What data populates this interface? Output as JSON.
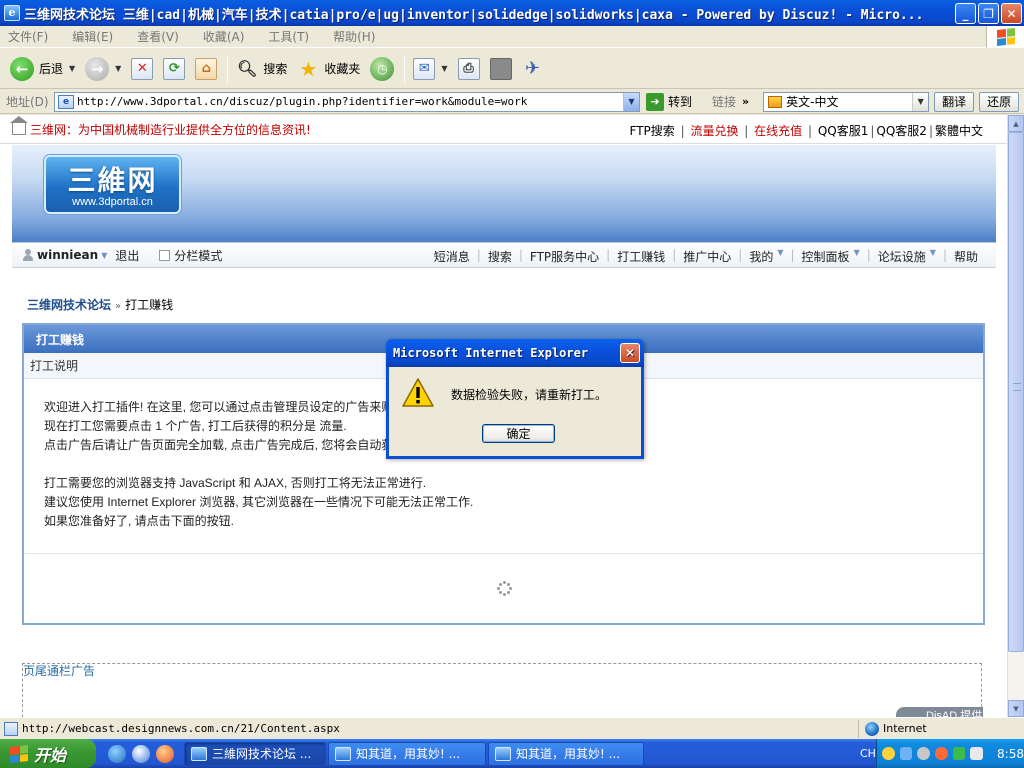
{
  "window": {
    "title": "三维网技术论坛 三维|cad|机械|汽车|技术|catia|pro/e|ug|inventor|solidedge|solidworks|caxa - Powered by Discuz! - Micro...",
    "min": "_",
    "max": "❐",
    "close": "✕"
  },
  "menu": [
    "文件(F)",
    "编辑(E)",
    "查看(V)",
    "收藏(A)",
    "工具(T)",
    "帮助(H)"
  ],
  "toolbar": {
    "back": "后退",
    "search": "搜索",
    "favorites": "收藏夹"
  },
  "address": {
    "label": "地址(D)",
    "url": "http://www.3dportal.cn/discuz/plugin.php?identifier=work&module=work",
    "goto": "转到",
    "links": "链接",
    "chevron": "»",
    "translate_select": "英文-中文",
    "translate_btn": "翻译",
    "restore_btn": "还原"
  },
  "page": {
    "slogan": "三维网：为中国机械制造行业提供全方位的信息资讯!",
    "toplinks": [
      {
        "text": "FTP搜索",
        "red": false
      },
      {
        "text": "流量兑换",
        "red": true
      },
      {
        "text": "在线充值",
        "red": true
      },
      {
        "text": "QQ客服1",
        "red": false
      },
      {
        "text": "QQ客服2",
        "red": false
      },
      {
        "text": "繁體中文",
        "red": false
      }
    ],
    "logo_big": "三維网",
    "logo_small": "www.3dportal.cn",
    "user": "winniean",
    "logout": "退出",
    "split_mode": "分栏模式",
    "nav": [
      "短消息",
      "搜索",
      "FTP服务中心",
      "打工赚钱",
      "推广中心",
      "我的",
      "控制面板",
      "论坛设施",
      "帮助"
    ],
    "breadcrumb_site": "三维网技术论坛",
    "breadcrumb_sep": "»",
    "breadcrumb_current": "打工赚钱",
    "box_title": "打工赚钱",
    "box_subtitle": "打工说明",
    "box_lines": [
      "欢迎进入打工插件! 在这里, 您可以通过点击管理员设定的广告来赚",
      "现在打工您需要点击  1 个广告, 打工后获得的积分是  流量.",
      "点击广告后请让广告页面完全加载, 点击广告完成后, 您将会自动获"
    ],
    "box_lines2": [
      "打工需要您的浏览器支持  JavaScript 和  AJAX, 否则打工将无法正常进行.",
      "建议您使用  Internet Explorer 浏览器, 其它浏览器在一些情况下可能无法正常工作.",
      "如果您准备好了, 请点击下面的按钮."
    ],
    "ad_label": "页尾通栏广告",
    "ad_badge": "DisAD 提供"
  },
  "status": {
    "text": "http://webcast.designnews.com.cn/21/Content.aspx",
    "zone": "Internet"
  },
  "taskbar": {
    "start": "开始",
    "tasks": [
      "三維网技术论坛 ...",
      "知其道，用其妙! ...",
      "知其道，用其妙! ..."
    ],
    "lang": "CH",
    "clock": "8:58"
  },
  "dialog": {
    "title": "Microsoft Internet Explorer",
    "message": "数据检验失败，请重新打工。",
    "ok": "确定"
  }
}
